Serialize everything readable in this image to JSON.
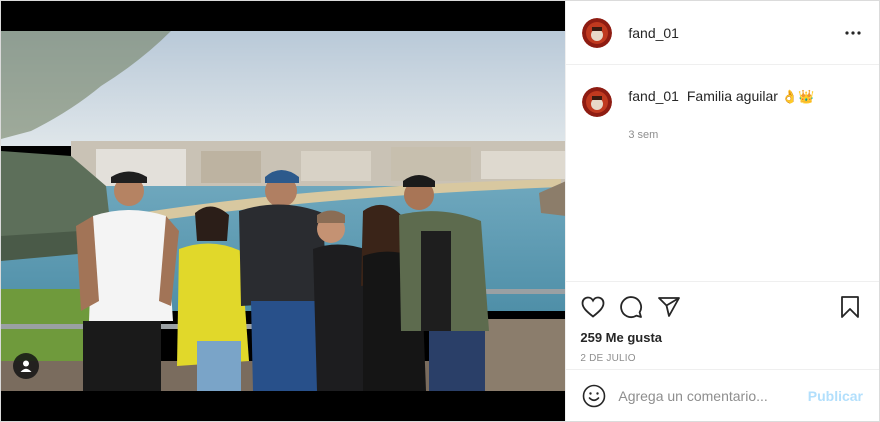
{
  "post": {
    "username": "fand_01",
    "caption_user": "fand_01",
    "caption_text": "Familia aguilar",
    "caption_emoji_1": "👌",
    "caption_emoji_2": "👑",
    "time_ago": "3 sem",
    "likes": "259 Me gusta",
    "date": "2 DE JULIO"
  },
  "comment_box": {
    "placeholder": "Agrega un comentario...",
    "publish_label": "Publicar"
  },
  "icons": {
    "more": "more-options-icon",
    "like": "heart-icon",
    "comment": "comment-icon",
    "share": "share-icon",
    "save": "bookmark-icon",
    "emoji": "emoji-icon",
    "tag": "user-tag-icon"
  },
  "colors": {
    "text": "#262626",
    "muted": "#8e8e8e",
    "border": "#efefef",
    "publish_disabled": "#b2dffc"
  }
}
